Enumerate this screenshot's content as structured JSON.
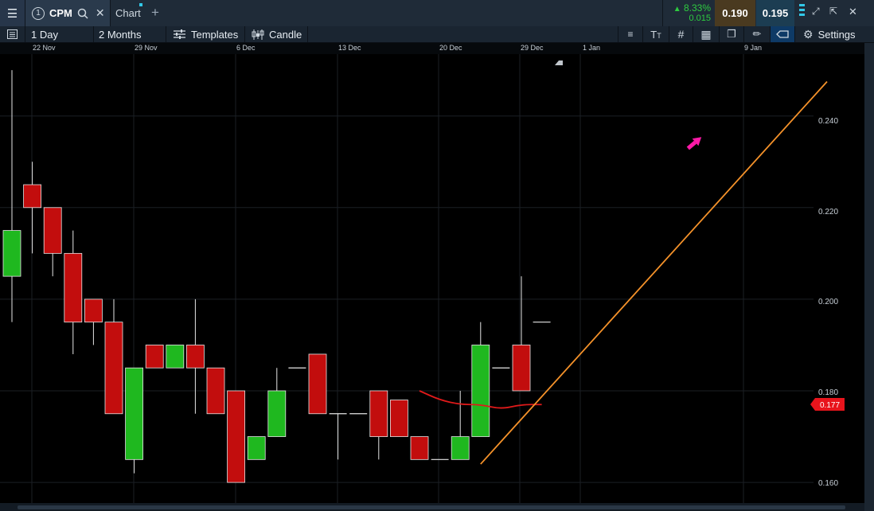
{
  "tabs": {
    "menu_icon": "hamburger-menu-icon",
    "symbol_number": "1",
    "symbol": "CPM",
    "chart_tab": "Chart",
    "add_icon": "plus-icon"
  },
  "quote": {
    "change_pct": "8.33%",
    "change_abs": "0.015",
    "bid": "0.190",
    "ask": "0.195",
    "up_color": "#2ecc40",
    "bid_bg": "#4a3a20",
    "ask_bg": "#1c3d52"
  },
  "toolbar": {
    "interval": "1 Day",
    "range": "2 Months",
    "templates": "Templates",
    "chart_style": "Candle",
    "settings": "Settings"
  },
  "date_axis": [
    "22 Nov",
    "29 Nov",
    "6 Dec",
    "13 Dec",
    "20 Dec",
    "29 Dec",
    "1 Jan",
    "9 Jan"
  ],
  "price_axis": [
    "0.240",
    "0.220",
    "0.200",
    "0.180",
    "0.160"
  ],
  "current_price": {
    "label": "0.177",
    "color": "#e8141c"
  },
  "chart_data": {
    "type": "candlestick",
    "symbol": "CPM",
    "interval": "1 Day",
    "ylim": [
      0.1555,
      0.2535
    ],
    "up_color": "#1fb81f",
    "down_color": "#c20d0d",
    "candles": [
      {
        "open": 0.205,
        "high": 0.25,
        "low": 0.195,
        "close": 0.215
      },
      {
        "open": 0.225,
        "high": 0.23,
        "low": 0.21,
        "close": 0.22
      },
      {
        "open": 0.22,
        "high": 0.22,
        "low": 0.205,
        "close": 0.21
      },
      {
        "open": 0.21,
        "high": 0.215,
        "low": 0.188,
        "close": 0.195
      },
      {
        "open": 0.2,
        "high": 0.2,
        "low": 0.19,
        "close": 0.195
      },
      {
        "open": 0.195,
        "high": 0.2,
        "low": 0.175,
        "close": 0.175
      },
      {
        "open": 0.165,
        "high": 0.185,
        "low": 0.162,
        "close": 0.185
      },
      {
        "open": 0.19,
        "high": 0.19,
        "low": 0.185,
        "close": 0.185
      },
      {
        "open": 0.185,
        "high": 0.19,
        "low": 0.185,
        "close": 0.19
      },
      {
        "open": 0.19,
        "high": 0.2,
        "low": 0.175,
        "close": 0.185
      },
      {
        "open": 0.185,
        "high": 0.185,
        "low": 0.175,
        "close": 0.175
      },
      {
        "open": 0.18,
        "high": 0.18,
        "low": 0.16,
        "close": 0.16
      },
      {
        "open": 0.165,
        "high": 0.17,
        "low": 0.165,
        "close": 0.17
      },
      {
        "open": 0.17,
        "high": 0.185,
        "low": 0.17,
        "close": 0.18
      },
      {
        "open": 0.185,
        "high": 0.185,
        "low": 0.185,
        "close": 0.185
      },
      {
        "open": 0.188,
        "high": 0.188,
        "low": 0.175,
        "close": 0.175
      },
      {
        "open": 0.175,
        "high": 0.175,
        "low": 0.165,
        "close": 0.175
      },
      {
        "open": 0.175,
        "high": 0.175,
        "low": 0.175,
        "close": 0.175
      },
      {
        "open": 0.18,
        "high": 0.18,
        "low": 0.165,
        "close": 0.17
      },
      {
        "open": 0.178,
        "high": 0.178,
        "low": 0.17,
        "close": 0.17
      },
      {
        "open": 0.17,
        "high": 0.17,
        "low": 0.165,
        "close": 0.165
      },
      {
        "open": 0.165,
        "high": 0.165,
        "low": 0.165,
        "close": 0.165
      },
      {
        "open": 0.165,
        "high": 0.18,
        "low": 0.165,
        "close": 0.17
      },
      {
        "open": 0.17,
        "high": 0.195,
        "low": 0.17,
        "close": 0.19
      },
      {
        "open": 0.185,
        "high": 0.185,
        "low": 0.185,
        "close": 0.185
      },
      {
        "open": 0.19,
        "high": 0.205,
        "low": 0.18,
        "close": 0.18
      },
      {
        "open": 0.195,
        "high": 0.195,
        "low": 0.195,
        "close": 0.195
      }
    ],
    "moving_average": {
      "color": "#e01a1a",
      "start_index": 20,
      "values": [
        0.18,
        0.178,
        0.177,
        0.177,
        0.176,
        0.177,
        0.177
      ]
    },
    "trendline": {
      "color": "#f5922a",
      "from_index": 23,
      "from_price": 0.164,
      "to_index": 40,
      "to_price": 0.2475
    },
    "annotation_arrow": {
      "color": "#ff1aa8",
      "direction": "up-right"
    }
  }
}
